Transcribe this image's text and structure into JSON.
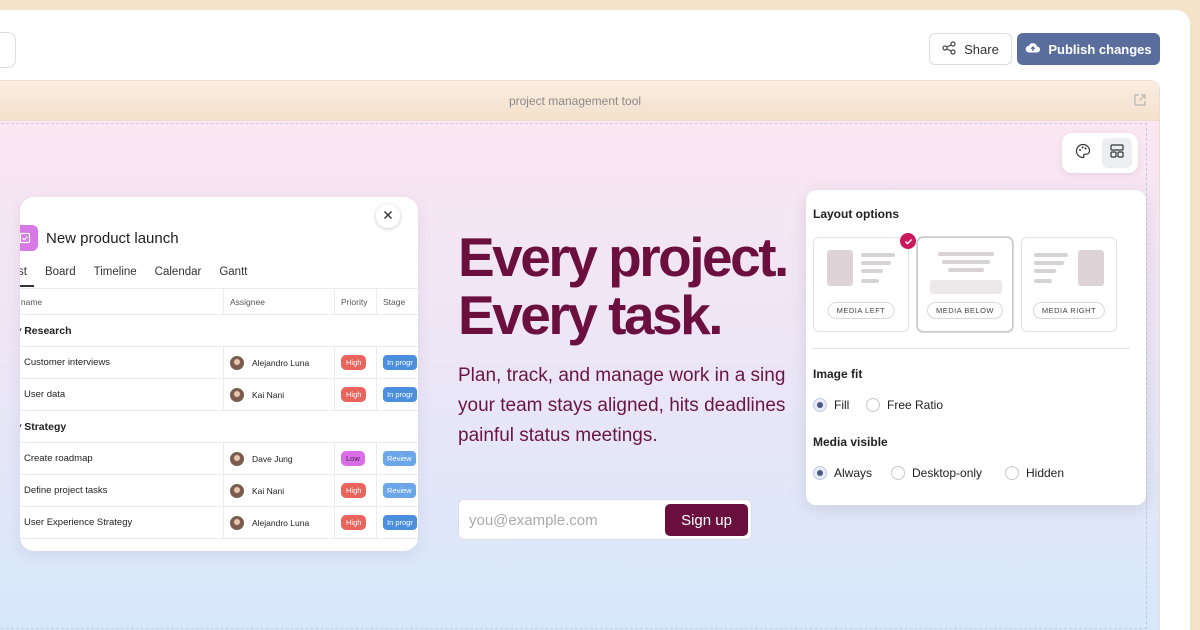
{
  "header": {
    "share_label": "Share",
    "publish_label": "Publish changes",
    "colors": {
      "publish_bg": "#5a6e9e"
    }
  },
  "browser": {
    "url_title": "project management tool"
  },
  "card": {
    "title": "New product launch",
    "tabs": [
      "st",
      "Board",
      "Timeline",
      "Calendar",
      "Gantt"
    ],
    "columns": [
      "sk name",
      "Assignee",
      "Priority",
      "Stage"
    ],
    "sections": [
      {
        "name": "Research",
        "rows": [
          {
            "task": "Customer interviews",
            "assignee": "Alejandro Luna",
            "priority": "High",
            "stage": "In progr"
          },
          {
            "task": "User data",
            "assignee": "Kai Nani",
            "priority": "High",
            "stage": "In progr"
          }
        ]
      },
      {
        "name": "Strategy",
        "rows": [
          {
            "task": "Create roadmap",
            "assignee": "Dave Jung",
            "priority": "Low",
            "stage": "Review"
          },
          {
            "task": "Define project tasks",
            "assignee": "Kai Nani",
            "priority": "High",
            "stage": "Review"
          },
          {
            "task": "User Experience Strategy",
            "assignee": "Alejandro Luna",
            "priority": "High",
            "stage": "In progr"
          }
        ]
      }
    ]
  },
  "hero": {
    "headline_line1": "Every project.",
    "headline_line2": "Every task.",
    "sub_line1": "Plan, track, and manage work in a sing",
    "sub_line2": "your team stays aligned, hits deadlines",
    "sub_line3": "painful status meetings.",
    "email_placeholder": "you@example.com",
    "signup_label": "Sign up",
    "colors": {
      "headline": "#6b0f3f"
    }
  },
  "panel": {
    "layout_title": "Layout options",
    "layout_options": [
      {
        "label": "MEDIA LEFT",
        "selected": false,
        "checked": true
      },
      {
        "label": "MEDIA BELOW",
        "selected": true,
        "checked": false
      },
      {
        "label": "MEDIA RIGHT",
        "selected": false,
        "checked": false
      }
    ],
    "image_fit_title": "Image fit",
    "image_fit_options": [
      {
        "label": "Fill",
        "selected": true
      },
      {
        "label": "Free Ratio",
        "selected": false
      }
    ],
    "media_visible_title": "Media visible",
    "media_visible_options": [
      {
        "label": "Always",
        "selected": true
      },
      {
        "label": "Desktop-only",
        "selected": false
      },
      {
        "label": "Hidden",
        "selected": false
      }
    ],
    "colors": {
      "check_badge": "#c9185c"
    }
  }
}
